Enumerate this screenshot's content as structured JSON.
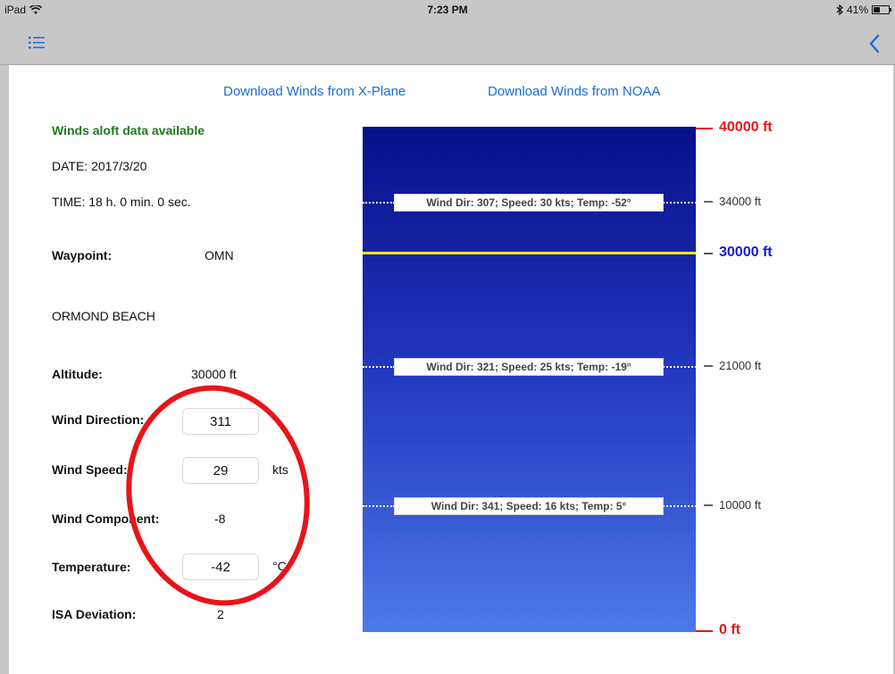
{
  "status_bar": {
    "device": "iPad",
    "time": "7:23 PM",
    "battery": "41%",
    "battery_level": 0.41
  },
  "nav": {
    "menu_icon": "list-icon",
    "back_icon": "chevron-left-icon"
  },
  "links": {
    "xplane": "Download Winds from X-Plane",
    "noaa": "Download Winds from NOAA"
  },
  "info": {
    "status": "Winds aloft data available",
    "date": "DATE: 2017/3/20",
    "time": "TIME: 18 h. 0 min. 0 sec.",
    "waypoint_label": "Waypoint:",
    "waypoint_value": "OMN",
    "waypoint_name": "ORMOND BEACH",
    "altitude_label": "Altitude:",
    "altitude_value": "30000 ft",
    "wind_direction_label": "Wind Direction:",
    "wind_direction_value": "311",
    "wind_speed_label": "Wind Speed:",
    "wind_speed_value": "29",
    "wind_speed_unit": "kts",
    "wind_component_label": "Wind Component:",
    "wind_component_value": "-8",
    "temperature_label": "Temperature:",
    "temperature_value": "-42",
    "temperature_unit": "°C",
    "isa_label": "ISA Deviation:",
    "isa_value": "2"
  },
  "altitude_chart": {
    "top_label": "40000 ft",
    "current_label": "30000 ft",
    "bottom_label": "0 ft",
    "levels": [
      {
        "altitude": "34000 ft",
        "text": "Wind Dir: 307; Speed: 30 kts; Temp: -52°"
      },
      {
        "altitude": "21000 ft",
        "text": "Wind Dir: 321; Speed: 25 kts; Temp: -19°"
      },
      {
        "altitude": "10000 ft",
        "text": "Wind Dir: 341; Speed: 16 kts; Temp: 5°"
      }
    ]
  },
  "colors": {
    "link": "#1a6fd6",
    "status_green": "#1e7a1e",
    "top_red": "#e8141a",
    "current_blue": "#1515d6",
    "current_line": "#f2e312",
    "annotation": "#e8141a"
  }
}
